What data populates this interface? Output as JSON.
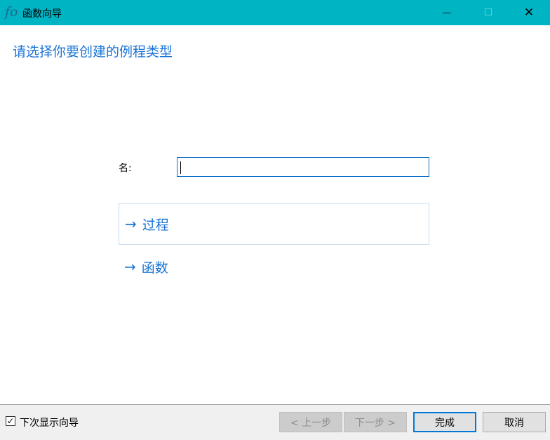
{
  "window": {
    "title": "函数向导",
    "app_icon": "fo",
    "minimize": "—",
    "maximize": "☐",
    "close": "✕"
  },
  "heading": "请选择你要创建的例程类型",
  "name_field": {
    "label": "名:",
    "value": ""
  },
  "options": [
    {
      "arrow": "→",
      "label": "过程"
    },
    {
      "arrow": "→",
      "label": "函数"
    }
  ],
  "footer": {
    "show_wizard_label": "下次显示向导",
    "show_wizard_checked": true,
    "check": "✓",
    "back": "< 上一步",
    "next": "下一步 >",
    "finish": "完成",
    "cancel": "取消"
  }
}
